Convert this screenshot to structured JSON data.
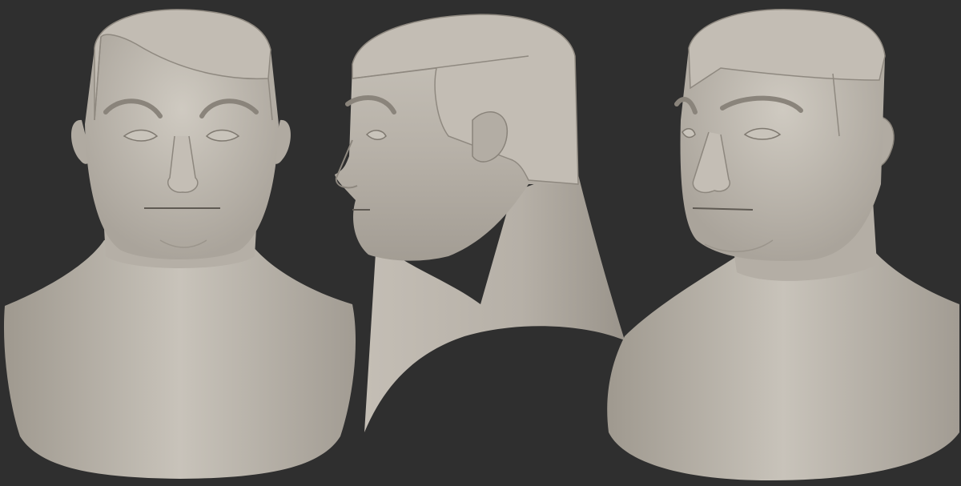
{
  "scene": {
    "background_color": "#2f2f2f",
    "clay_color": "#b9b3aa",
    "views": [
      {
        "name": "front"
      },
      {
        "name": "side-profile"
      },
      {
        "name": "three-quarter"
      }
    ]
  }
}
